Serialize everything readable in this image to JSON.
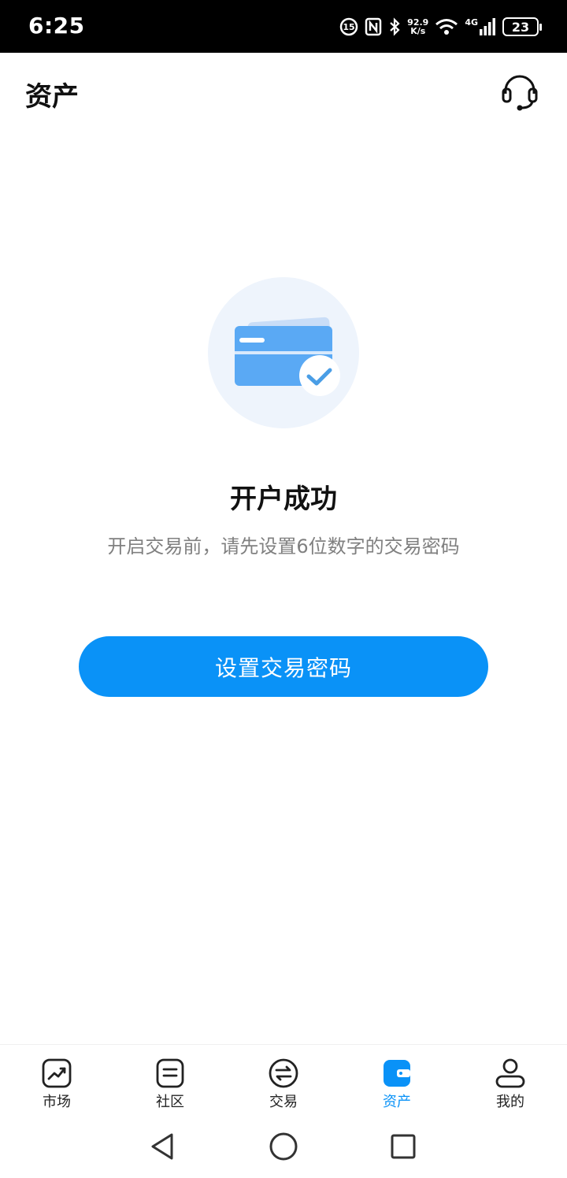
{
  "status_bar": {
    "time": "6:25",
    "net_speed_value": "92.9",
    "net_speed_unit": "K/s",
    "network_type": "4G",
    "battery": "23"
  },
  "header": {
    "title": "资产",
    "support_icon": "headset-icon"
  },
  "main": {
    "illustration_icon": "card-check-icon",
    "title": "开户成功",
    "description": "开启交易前，请先设置6位数字的交易密码",
    "button_label": "设置交易密码"
  },
  "tab_bar": {
    "items": [
      {
        "label": "市场",
        "icon": "chart-icon",
        "active": false
      },
      {
        "label": "社区",
        "icon": "document-icon",
        "active": false
      },
      {
        "label": "交易",
        "icon": "exchange-icon",
        "active": false
      },
      {
        "label": "资产",
        "icon": "wallet-icon",
        "active": true
      },
      {
        "label": "我的",
        "icon": "user-icon",
        "active": false
      }
    ]
  },
  "system_nav": {
    "back_icon": "back-triangle-icon",
    "home_icon": "home-circle-icon",
    "recents_icon": "recents-square-icon"
  },
  "colors": {
    "accent": "#0a92f7",
    "status_bar_bg": "#000000",
    "secondary_text": "#808080",
    "card_blue": "#5aa9f4"
  }
}
